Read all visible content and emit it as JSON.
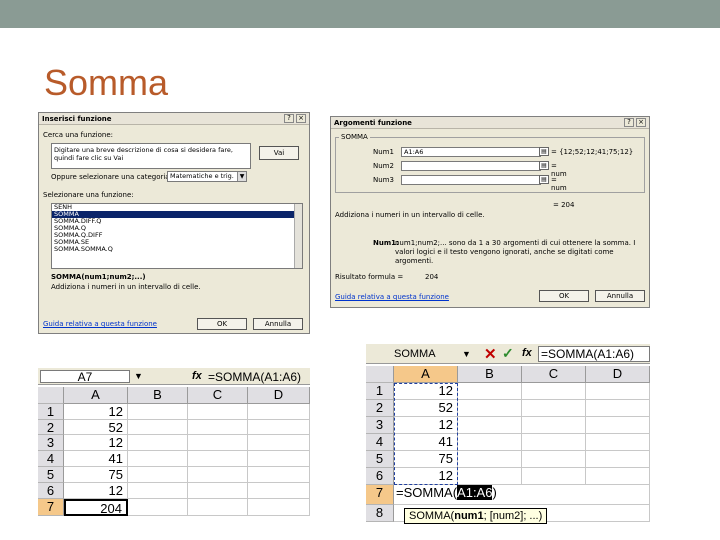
{
  "slide": {
    "title": "Somma"
  },
  "dialog_insert": {
    "title": "Inserisci funzione",
    "search_label": "Cerca una funzione:",
    "search_text": "Digitare una breve descrizione di cosa si desidera fare, quindi fare clic su Vai",
    "go_button": "Vai",
    "category_label": "Oppure selezionare una categoria:",
    "category_value": "Matematiche e trig.",
    "select_label": "Selezionare una funzione:",
    "functions": [
      "SENH",
      "SOMMA",
      "SOMMA.DIFF.Q",
      "SOMMA.Q",
      "SOMMA.Q.DIFF",
      "SOMMA.SE",
      "SOMMA.SOMMA.Q"
    ],
    "selected_function": "SOMMA",
    "signature": "SOMMA(num1;num2;...)",
    "description": "Addiziona i numeri in un intervallo di celle.",
    "help_link": "Guida relativa a questa funzione",
    "ok": "OK",
    "cancel": "Annulla"
  },
  "dialog_args": {
    "title": "Argomenti funzione",
    "group_label": "SOMMA",
    "args": [
      {
        "label": "Num1",
        "value": "A1:A6",
        "result": "= {12;52;12;41;75;12}"
      },
      {
        "label": "Num2",
        "value": "",
        "result": "= num"
      },
      {
        "label": "Num3",
        "value": "",
        "result": "= num"
      }
    ],
    "total": "= 204",
    "description": "Addiziona i numeri in un intervallo di celle.",
    "arg_help_label": "Num1:",
    "arg_help": "num1;num2;... sono da 1 a 30 argomenti di cui ottenere la somma. I valori logici e il testo vengono ignorati, anche se digitati come argomenti.",
    "result_label": "Risultato formula =",
    "result_value": "204",
    "help_link": "Guida relativa a questa funzione",
    "ok": "OK",
    "cancel": "Annulla"
  },
  "sheet_left": {
    "name_box": "A7",
    "fx": "fx",
    "formula": "=SOMMA(A1:A6)",
    "columns": [
      "A",
      "B",
      "C",
      "D"
    ],
    "rows": [
      "1",
      "2",
      "3",
      "4",
      "5",
      "6",
      "7"
    ],
    "values": [
      "12",
      "52",
      "12",
      "41",
      "75",
      "12",
      "204"
    ]
  },
  "sheet_right": {
    "name_box": "SOMMA",
    "cancel_icon": "✕",
    "enter_icon": "✓",
    "fx": "fx",
    "formula": "=SOMMA(A1:A6)",
    "columns": [
      "A",
      "B",
      "C",
      "D"
    ],
    "rows": [
      "1",
      "2",
      "3",
      "4",
      "5",
      "6",
      "7",
      "8"
    ],
    "values": [
      "12",
      "52",
      "12",
      "41",
      "75",
      "12"
    ],
    "editing_prefix": "=SOMMA(",
    "editing_range": "A1:A6",
    "editing_suffix": ")",
    "tooltip_fn": "SOMMA(",
    "tooltip_bold": "num1",
    "tooltip_rest": "; [num2]; ...)"
  }
}
